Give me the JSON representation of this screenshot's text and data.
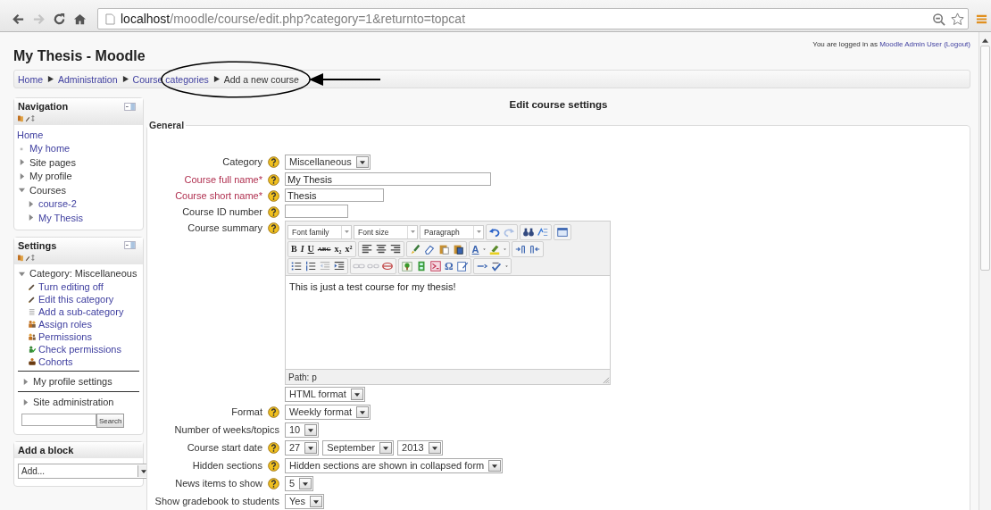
{
  "browser": {
    "url_host": "localhost",
    "url_path": "/moodle/course/edit.php?category=1&returnto=topcat",
    "forward_disabled": true
  },
  "header": {
    "title": "My Thesis - Moodle",
    "login_text": "You are logged in as",
    "user": "Moodle Admin User",
    "logout": "(Logout)"
  },
  "breadcrumb": [
    {
      "label": "Home",
      "link": true
    },
    {
      "label": "Administration",
      "link": true
    },
    {
      "label": "Course categories",
      "link": true
    },
    {
      "label": "Add a new course",
      "link": false
    }
  ],
  "navigation": {
    "title": "Navigation",
    "items": [
      {
        "label": "Home",
        "kind": "root",
        "link": true,
        "children": [
          {
            "label": "My home",
            "kind": "leaf",
            "link": true
          },
          {
            "label": "Site pages",
            "kind": "branch",
            "expanded": false,
            "link": false
          },
          {
            "label": "My profile",
            "kind": "branch",
            "expanded": false,
            "link": false
          },
          {
            "label": "Courses",
            "kind": "branch",
            "expanded": true,
            "link": false,
            "children": [
              {
                "label": "course-2",
                "kind": "branch",
                "expanded": false,
                "link": true
              },
              {
                "label": "My Thesis",
                "kind": "branch",
                "expanded": false,
                "link": true
              }
            ]
          }
        ]
      }
    ]
  },
  "settings": {
    "title": "Settings",
    "items": [
      {
        "label": "Category: Miscellaneous",
        "kind": "branch",
        "expanded": true,
        "link": false,
        "children": [
          {
            "label": "Turn editing off",
            "kind": "pencil",
            "link": true
          },
          {
            "label": "Edit this category",
            "kind": "pencil",
            "link": true
          },
          {
            "label": "Add a sub-category",
            "kind": "list",
            "link": true
          },
          {
            "label": "Assign roles",
            "kind": "roles",
            "link": true
          },
          {
            "label": "Permissions",
            "kind": "permissions",
            "link": true
          },
          {
            "label": "Check permissions",
            "kind": "check",
            "link": true
          },
          {
            "label": "Cohorts",
            "kind": "cohorts",
            "link": true
          }
        ]
      },
      {
        "label": "My profile settings",
        "kind": "branch",
        "expanded": false,
        "link": false
      },
      {
        "label": "Site administration",
        "kind": "branch",
        "expanded": false,
        "link": false
      }
    ],
    "search_button": "Search"
  },
  "add_block": {
    "title": "Add a block",
    "select": "Add..."
  },
  "form": {
    "heading": "Edit course settings",
    "legend": "General",
    "rows": [
      {
        "label": "Category",
        "required": false,
        "help": true,
        "kind": "select",
        "value": "Miscellaneous"
      },
      {
        "label": "Course full name*",
        "required": true,
        "help": true,
        "kind": "text",
        "value": "My Thesis"
      },
      {
        "label": "Course short name*",
        "required": true,
        "help": true,
        "kind": "text",
        "value": "Thesis"
      },
      {
        "label": "Course ID number",
        "required": false,
        "help": true,
        "kind": "text"
      },
      {
        "label": "Course summary",
        "required": false,
        "help": true,
        "kind": "editor",
        "editor": {
          "selects": [
            "Font family",
            "Font size",
            "Paragraph"
          ],
          "rows": [
            [
              [
                {
                  "kind": "undo",
                  "disabled": false
                },
                {
                  "kind": "redo",
                  "disabled": true
                }
              ],
              [
                {
                  "kind": "find",
                  "disabled": false
                },
                {
                  "kind": "replace",
                  "disabled": false
                }
              ],
              [
                {
                  "kind": "fullscreen",
                  "disabled": false
                }
              ]
            ],
            [
              [
                {
                  "kind": "bold",
                  "label": "B",
                  "disabled": false
                },
                {
                  "kind": "italic",
                  "label": "I",
                  "disabled": false
                },
                {
                  "kind": "underline",
                  "label": "U",
                  "disabled": false
                },
                {
                  "kind": "strike",
                  "label": "ABC",
                  "disabled": false
                },
                {
                  "kind": "sub",
                  "label": "x₂",
                  "disabled": false
                },
                {
                  "kind": "sup",
                  "label": "x²",
                  "disabled": false
                }
              ],
              [
                {
                  "kind": "alignleft",
                  "disabled": false
                },
                {
                  "kind": "aligncenter",
                  "disabled": false
                },
                {
                  "kind": "alignright",
                  "disabled": false
                }
              ],
              [
                {
                  "kind": "cleanup",
                  "disabled": false
                },
                {
                  "kind": "eraser",
                  "disabled": false
                },
                {
                  "kind": "pastetext",
                  "disabled": false
                },
                {
                  "kind": "pasteword",
                  "disabled": false
                }
              ],
              [
                {
                  "kind": "color",
                  "label": "A",
                  "disabled": false
                },
                {
                  "kind": "dropdown",
                  "disabled": false
                },
                {
                  "kind": "highlight",
                  "disabled": false
                },
                {
                  "kind": "dropdown",
                  "disabled": false
                }
              ],
              [
                {
                  "kind": "ltr",
                  "disabled": false
                },
                {
                  "kind": "rtl",
                  "disabled": false
                }
              ]
            ],
            [
              [
                {
                  "kind": "bullist",
                  "disabled": false
                },
                {
                  "kind": "numlist",
                  "disabled": false
                },
                {
                  "kind": "outdent",
                  "disabled": true
                },
                {
                  "kind": "indent",
                  "disabled": false
                }
              ],
              [
                {
                  "kind": "link",
                  "disabled": true
                },
                {
                  "kind": "unlink",
                  "disabled": true
                },
                {
                  "kind": "anchor",
                  "disabled": false
                }
              ],
              [
                {
                  "kind": "image",
                  "disabled": false
                },
                {
                  "kind": "media",
                  "disabled": false
                },
                {
                  "kind": "equation",
                  "disabled": false
                },
                {
                  "kind": "symbol",
                  "label": "Ω",
                  "disabled": false
                },
                {
                  "kind": "edit",
                  "disabled": false
                }
              ],
              [
                {
                  "kind": "html",
                  "disabled": false
                },
                {
                  "kind": "spell",
                  "disabled": false
                },
                {
                  "kind": "dropdown",
                  "disabled": false
                }
              ]
            ]
          ],
          "text": "This is just a test course for my thesis!",
          "path": "Path: p",
          "format": "HTML format"
        }
      },
      {
        "label": "Format",
        "required": false,
        "help": true,
        "kind": "select",
        "value": "Weekly format"
      },
      {
        "label": "Number of weeks/topics",
        "required": false,
        "help": false,
        "kind": "select",
        "value": "10"
      },
      {
        "label": "Course start date",
        "required": false,
        "help": true,
        "kind": "date",
        "values": [
          "27",
          "September",
          "2013"
        ]
      },
      {
        "label": "Hidden sections",
        "required": false,
        "help": true,
        "kind": "select",
        "value": "Hidden sections are shown in collapsed form"
      },
      {
        "label": "News items to show",
        "required": false,
        "help": true,
        "kind": "select",
        "value": "5"
      },
      {
        "label": "Show gradebook to students",
        "required": false,
        "help": false,
        "kind": "select",
        "value": "Yes"
      }
    ]
  }
}
